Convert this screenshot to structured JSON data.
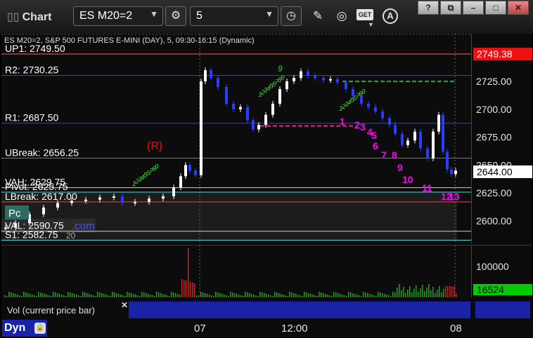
{
  "toolbar": {
    "title": "Chart",
    "symbol": "ES M20=2",
    "interval": "5",
    "get_label": "GET",
    "a_label": "A",
    "window_controls": [
      "?",
      "⧉",
      "–",
      "□",
      "✕"
    ]
  },
  "chart": {
    "header": "ES M20=2, S&P 500 FUTURES E-MINI (DAY), 5, 09:30-16:15 (Dynamic)",
    "levels": [
      {
        "label": "UP1: 2749.50",
        "value": 2749.5,
        "color": "#ff6060"
      },
      {
        "label": "R2: 2730.25",
        "value": 2730.25,
        "color": "#2244ff"
      },
      {
        "label": "R1: 2687.50",
        "value": 2687.5,
        "color": "#2244ff"
      },
      {
        "label": "UBreak: 2656.25",
        "value": 2656.25,
        "color": "#ff4040"
      },
      {
        "label": "VAH: 2629.75",
        "value": 2629.75,
        "color": "#d0d0d0"
      },
      {
        "label": "Pivot: 2625.75",
        "value": 2625.75,
        "color": "#40e0e0"
      },
      {
        "label": "LBreak: 2617.00",
        "value": 2617.0,
        "color": "#ff4040"
      },
      {
        "label": "VAL: 2590.75",
        "value": 2590.75,
        "color": "#d0d0d0"
      },
      {
        "label": "S1: 2582.75",
        "value": 2582.75,
        "color": "#40e0e0"
      }
    ],
    "axis_ticks": [
      "2725.00",
      "2700.00",
      "2675.00",
      "2650.00",
      "2625.00",
      "2600.00"
    ],
    "last_price": "2644.00",
    "up1_tag": "2749.38",
    "r_marker": "(R)",
    "pc_label": "Pc",
    "com_label": ".com",
    "small_label": "20",
    "count_labels": [
      "1",
      "2",
      "3",
      "4",
      "5",
      "6",
      "7",
      "8",
      "9",
      "10",
      "11",
      "12",
      "13"
    ],
    "buy_setup_label": "9",
    "green_counts": [
      "1",
      "2",
      "3",
      "4",
      "5",
      "6",
      "7",
      "8",
      "9"
    ],
    "time_labels": [
      "07",
      "12:00",
      "08"
    ],
    "colors": {
      "up_bar": "#ffffff",
      "down_bar": "#2a3cff",
      "count": "#ff00ff",
      "green": "#33cc33",
      "bg": "#000000"
    }
  },
  "volume": {
    "label": "Vol (current price bar)",
    "axis_tick": "100000",
    "last": "16524",
    "last_color": "#00cc00"
  },
  "status": {
    "dyn": "Dyn"
  }
}
